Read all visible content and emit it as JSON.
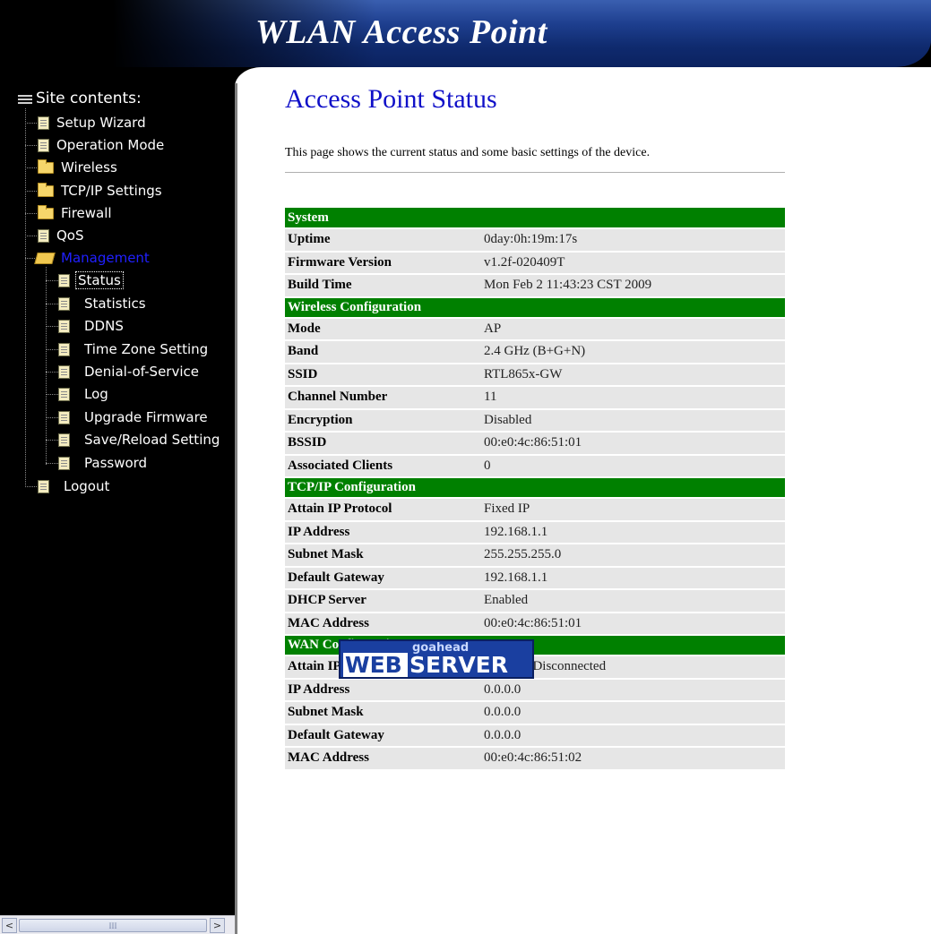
{
  "banner": {
    "title": "WLAN Access Point"
  },
  "nav": {
    "root_label": "Site contents:",
    "items": [
      {
        "label": "Setup Wizard"
      },
      {
        "label": "Operation Mode"
      },
      {
        "label": "Wireless"
      },
      {
        "label": "TCP/IP Settings"
      },
      {
        "label": "Firewall"
      },
      {
        "label": "QoS"
      },
      {
        "label": "Management"
      },
      {
        "label": "Status"
      },
      {
        "label": "Statistics"
      },
      {
        "label": "DDNS"
      },
      {
        "label": "Time Zone Setting"
      },
      {
        "label": "Denial-of-Service"
      },
      {
        "label": "Log"
      },
      {
        "label": "Upgrade Firmware"
      },
      {
        "label": "Save/Reload Setting"
      },
      {
        "label": "Password"
      },
      {
        "label": "Logout"
      }
    ]
  },
  "scrollbar": {
    "left_arrow": "<",
    "right_arrow": ">",
    "thumb_grip": "III"
  },
  "main": {
    "title": "Access Point Status",
    "description": "This page shows the current status and some basic settings of the device.",
    "sections": [
      {
        "heading": "System",
        "rows": [
          {
            "key": "Uptime",
            "value": "0day:0h:19m:17s"
          },
          {
            "key": "Firmware Version",
            "value": "v1.2f-020409T"
          },
          {
            "key": "Build Time",
            "value": "Mon Feb 2 11:43:23 CST 2009"
          }
        ]
      },
      {
        "heading": "Wireless Configuration",
        "rows": [
          {
            "key": "Mode",
            "value": "AP"
          },
          {
            "key": "Band",
            "value": "2.4 GHz (B+G+N)"
          },
          {
            "key": "SSID",
            "value": "RTL865x-GW"
          },
          {
            "key": "Channel Number",
            "value": "11"
          },
          {
            "key": "Encryption",
            "value": "Disabled"
          },
          {
            "key": "BSSID",
            "value": "00:e0:4c:86:51:01"
          },
          {
            "key": "Associated Clients",
            "value": "0"
          }
        ]
      },
      {
        "heading": "TCP/IP Configuration",
        "rows": [
          {
            "key": "Attain IP Protocol",
            "value": "Fixed IP"
          },
          {
            "key": "IP Address",
            "value": "192.168.1.1"
          },
          {
            "key": "Subnet Mask",
            "value": "255.255.255.0"
          },
          {
            "key": "Default Gateway",
            "value": "192.168.1.1"
          },
          {
            "key": "DHCP Server",
            "value": "Enabled"
          },
          {
            "key": "MAC Address",
            "value": "00:e0:4c:86:51:01"
          }
        ]
      },
      {
        "heading": "WAN Configuration",
        "rows": [
          {
            "key": "Attain IP Protocol",
            "value": "Fixed IP Disconnected"
          },
          {
            "key": "IP Address",
            "value": "0.0.0.0"
          },
          {
            "key": "Subnet Mask",
            "value": "0.0.0.0"
          },
          {
            "key": "Default Gateway",
            "value": "0.0.0.0"
          },
          {
            "key": "MAC Address",
            "value": "00:e0:4c:86:51:02"
          }
        ]
      }
    ]
  },
  "logo": {
    "top": "goahead",
    "left": "WEB",
    "right": "SERVER"
  },
  "colors": {
    "section_bg": "#008000",
    "row_bg": "#e6e6e6",
    "title": "#1010c8",
    "nav_bg": "#000000",
    "active_nav": "#2020ff"
  },
  "icons": {
    "doc": "document-icon",
    "folder": "folder-icon",
    "folder_open": "folder-open-icon",
    "root": "tree-root-icon"
  }
}
